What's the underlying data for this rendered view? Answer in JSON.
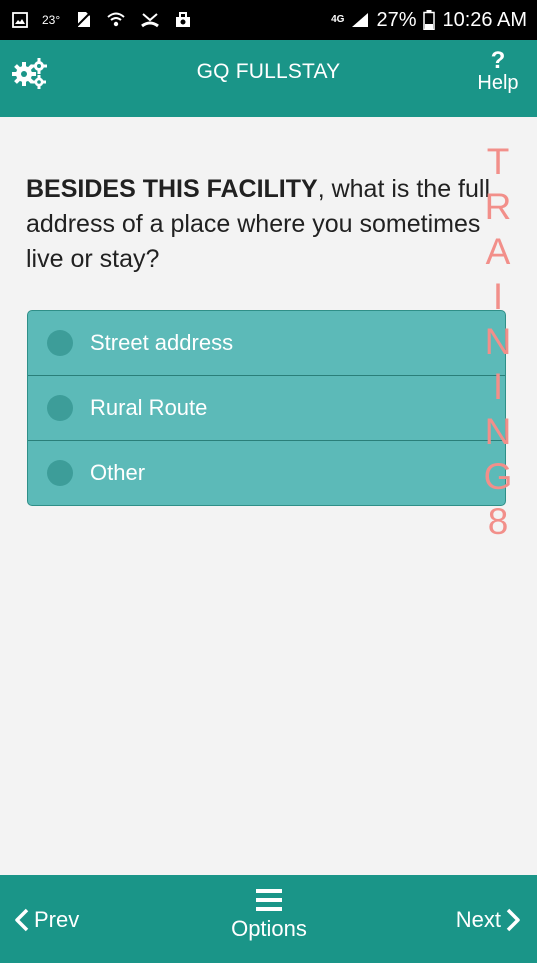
{
  "status_bar": {
    "temperature": "23°",
    "network": "4G",
    "battery": "27%",
    "time": "10:26 AM"
  },
  "app_bar": {
    "title": "GQ FULLSTAY",
    "help_label": "Help",
    "help_mark": "?"
  },
  "question": {
    "emphasis": "BESIDES THIS FACILITY",
    "text": ", what is the full address of a place where you sometimes live or stay?"
  },
  "options": [
    {
      "label": "Street address",
      "selected": false
    },
    {
      "label": "Rural Route",
      "selected": false
    },
    {
      "label": "Other",
      "selected": false
    }
  ],
  "watermark": {
    "letters": [
      "T",
      "R",
      "A",
      "I",
      "N",
      "I",
      "N",
      "G",
      "8"
    ]
  },
  "bottom_bar": {
    "prev_label": "Prev",
    "options_label": "Options",
    "next_label": "Next"
  },
  "colors": {
    "primary": "#1a9588",
    "option_bg": "#5cbab8",
    "watermark": "#f28f8a",
    "text": "#212121"
  },
  "icons": {
    "settings": "gears-icon",
    "help": "help-icon",
    "prev": "chevron-left-icon",
    "next": "chevron-right-icon",
    "options": "menu-icon"
  }
}
